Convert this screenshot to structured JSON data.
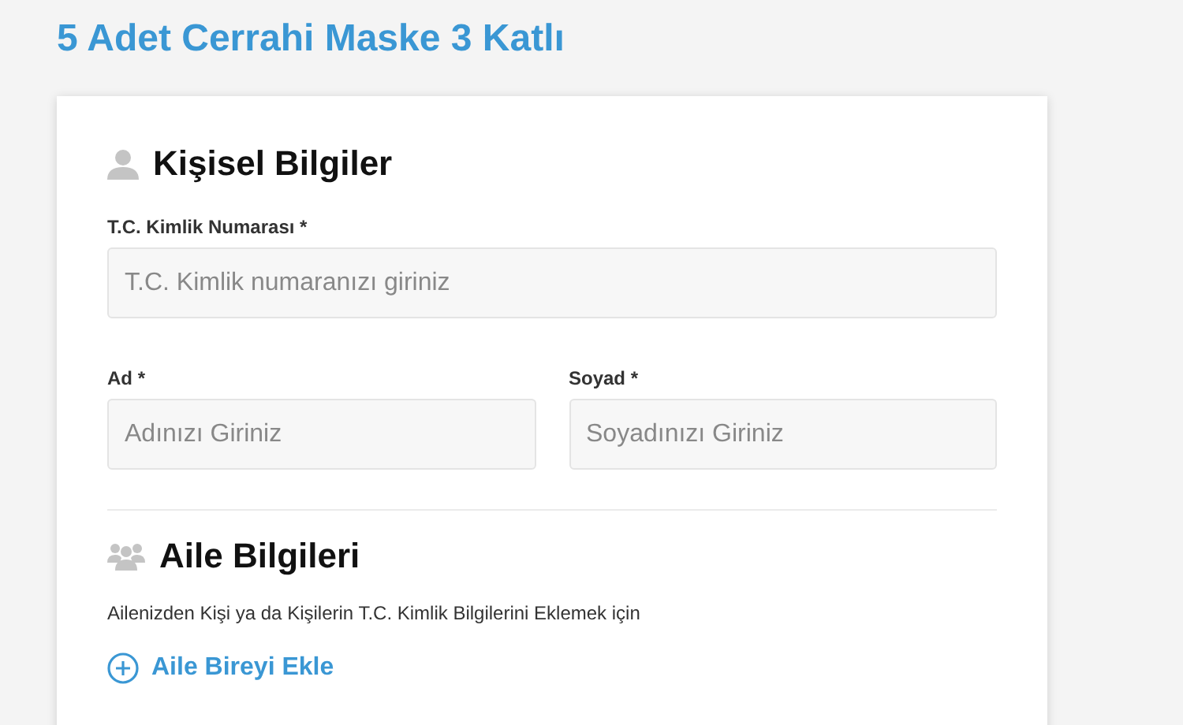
{
  "page_title": "5 Adet Cerrahi Maske 3 Katlı",
  "sections": [
    {
      "kind": "person",
      "title": "Kişisel Bilgiler",
      "rows": [
        [
          {
            "label": "T.C. Kimlik Numarası *",
            "placeholder": "T.C. Kimlik numaranızı giriniz"
          }
        ],
        [
          {
            "label": "Ad *",
            "placeholder": "Adınızı Giriniz"
          },
          {
            "label": "Soyad *",
            "placeholder": "Soyadınızı Giriniz"
          }
        ]
      ]
    },
    {
      "kind": "family",
      "title": "Aile Bilgileri",
      "description": "Ailenizden Kişi ya da Kişilerin T.C. Kimlik Bilgilerini Eklemek için",
      "action": "Aile Bireyi Ekle"
    }
  ]
}
